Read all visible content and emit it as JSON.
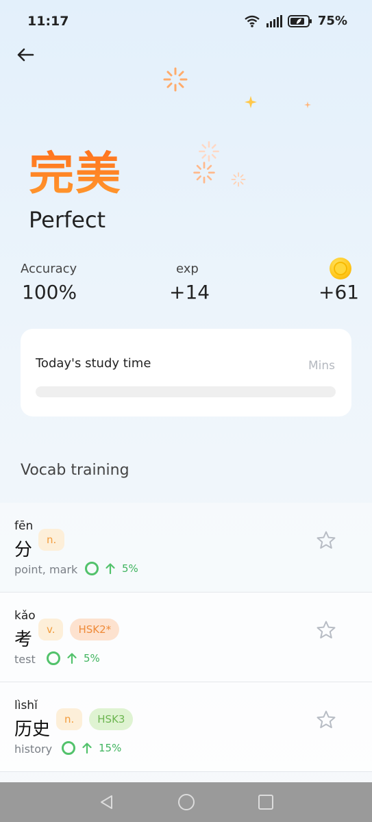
{
  "status_bar": {
    "time": "11:17",
    "battery": "75%",
    "icons": [
      "wifi-icon",
      "signal-icon",
      "battery-icon"
    ]
  },
  "header": {
    "back_icon": "arrow-left-icon"
  },
  "result": {
    "title_cn": "完美",
    "title_en": "Perfect"
  },
  "stats": {
    "accuracy_label": "Accuracy",
    "accuracy_value": "100%",
    "exp_label": "exp",
    "exp_value": "+14",
    "coins_icon": "coin-icon",
    "coins_value": "+61"
  },
  "study_card": {
    "title": "Today's study time",
    "unit": "Mins",
    "progress": 0
  },
  "vocab": {
    "section_title": "Vocab training",
    "items": [
      {
        "pinyin": "fēn",
        "hanzi": "分",
        "meaning": "point, mark",
        "pos": "n.",
        "hsk": "",
        "percent": "5%"
      },
      {
        "pinyin": "kǎo",
        "hanzi": "考",
        "meaning": "test",
        "pos": "v.",
        "hsk": "HSK2*",
        "percent": "5%"
      },
      {
        "pinyin": "lìshǐ",
        "hanzi": "历史",
        "meaning": "history",
        "pos": "n.",
        "hsk": "HSK3",
        "percent": "15%"
      }
    ]
  },
  "colors": {
    "accent_orange": "#ff7a1a",
    "green": "#3fb45e",
    "hsk2_bg": "#fde2cf",
    "hsk3_bg": "#dff3d2"
  },
  "nav_bar": {
    "icons": [
      "back-triangle-icon",
      "home-circle-icon",
      "recents-square-icon"
    ]
  }
}
